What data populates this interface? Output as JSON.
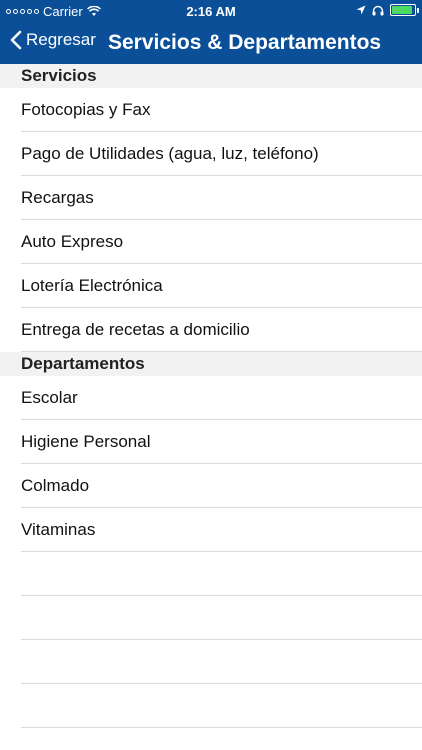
{
  "status_bar": {
    "carrier": "Carrier",
    "time": "2:16 AM",
    "battery_level": 0.9,
    "icons": [
      "signal-dots-icon",
      "wifi-icon",
      "location-arrow-icon",
      "headphones-icon",
      "battery-icon"
    ]
  },
  "nav": {
    "back_label": "Regresar",
    "title": "Servicios & Departamentos",
    "color": "#0b4f98"
  },
  "sections": [
    {
      "header": "Servicios",
      "items": [
        "Fotocopias y Fax",
        "Pago de Utilidades (agua, luz, teléfono)",
        "Recargas",
        "Auto Expreso",
        "Lotería Electrónica",
        "Entrega de recetas a domicilio"
      ]
    },
    {
      "header": "Departamentos",
      "items": [
        "Escolar",
        "Higiene Personal",
        "Colmado",
        "Vitaminas"
      ]
    }
  ]
}
